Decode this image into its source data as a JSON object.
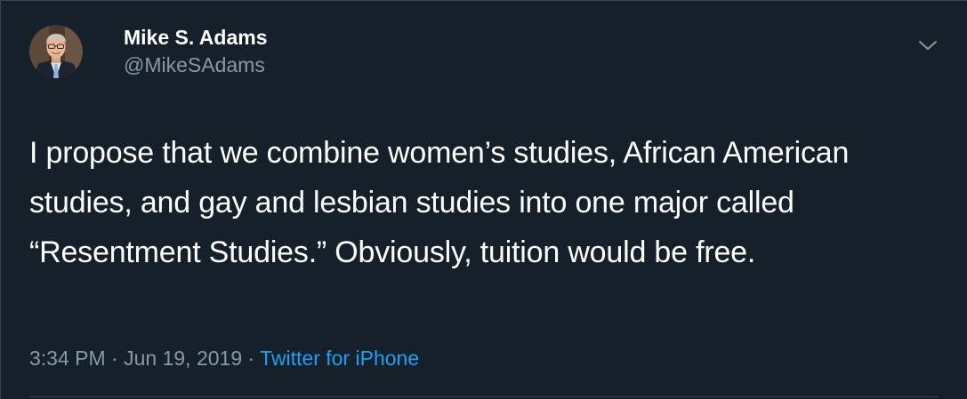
{
  "author": {
    "display_name": "Mike S. Adams",
    "handle": "@MikeSAdams"
  },
  "tweet": {
    "text": "I propose that we combine women’s studies, African American studies, and gay and lesbian studies into one major called “Resentment Studies.” Obviously, tuition would be free.",
    "time": "3:34 PM",
    "separator": "·",
    "date": "Jun 19, 2019",
    "source": "Twitter for iPhone"
  },
  "icons": {
    "menu": "chevron-down-icon",
    "avatar": "profile-photo"
  },
  "colors": {
    "background": "#15202b",
    "text_primary": "#ffffff",
    "text_secondary": "#8899a6",
    "link": "#1da1f2",
    "border": "#38444d"
  }
}
